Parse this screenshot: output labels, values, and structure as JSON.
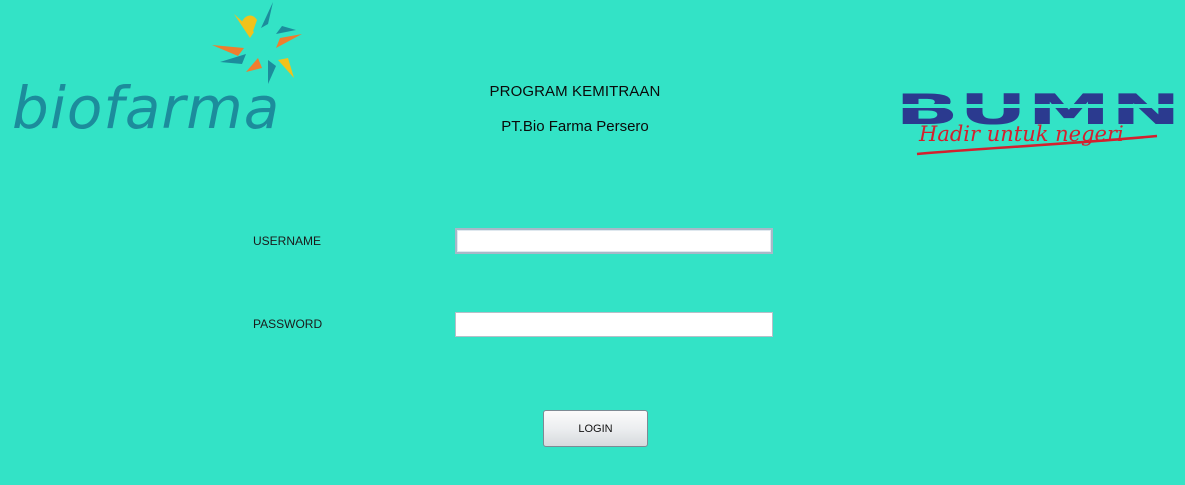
{
  "header": {
    "title": "PROGRAM KEMITRAAN",
    "subtitle": "PT.Bio Farma Persero"
  },
  "logos": {
    "left": {
      "icon": "biofarma-logo-icon",
      "text": "biofarma",
      "color": "#1c8c9c",
      "star_colors": [
        "#f2c21b",
        "#1c8c9c",
        "#ef7d2e"
      ]
    },
    "right": {
      "icon": "bumn-logo-icon",
      "text": "BUMN",
      "tagline": "Hadir untuk negeri",
      "color": "#2b3a8f",
      "tagline_color": "#d4202e"
    }
  },
  "form": {
    "username": {
      "label": "USERNAME",
      "value": "",
      "placeholder": ""
    },
    "password": {
      "label": "PASSWORD",
      "value": "",
      "placeholder": ""
    },
    "login_label": "LOGIN"
  },
  "colors": {
    "background": "#33e3c6"
  }
}
